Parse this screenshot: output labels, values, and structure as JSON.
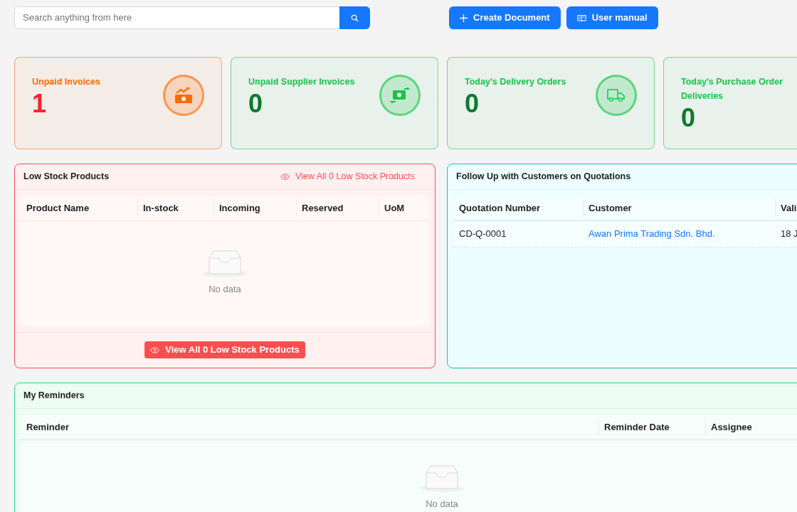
{
  "search": {
    "placeholder": "Search anything from here"
  },
  "actions": [
    {
      "label": "Create Document"
    },
    {
      "label": "User manual"
    }
  ],
  "stats": [
    {
      "label": "Unpaid Invoices",
      "value": "1",
      "color": "#ff6a00"
    },
    {
      "label": "Unpaid Supplier Invoices",
      "value": "0",
      "color": "#16c64a"
    },
    {
      "label": "Today's Delivery Orders",
      "value": "0",
      "color": "#16c64a"
    },
    {
      "label": "Today's Purchase Order Deliveries",
      "value": "0",
      "color": "#16c64a"
    }
  ],
  "low_stock": {
    "title": "Low Stock Products",
    "header_link": "View All 0 Low Stock Products",
    "columns": [
      "Product Name",
      "In-stock",
      "Incoming",
      "Reserved",
      "UoM"
    ],
    "empty_text": "No data",
    "footer_button": "View All 0 Low Stock Products"
  },
  "quotations": {
    "title": "Follow Up with Customers on Quotations",
    "columns": [
      "Quotation Number",
      "Customer",
      "Vali"
    ],
    "rows": [
      [
        "CD-Q-0001",
        "Awan Prima Trading Sdn. Bhd.",
        "18 J"
      ]
    ]
  },
  "reminders": {
    "title": "My Reminders",
    "columns": [
      "Reminder",
      "Reminder Date",
      "Assignee"
    ],
    "empty_text": "No data"
  }
}
